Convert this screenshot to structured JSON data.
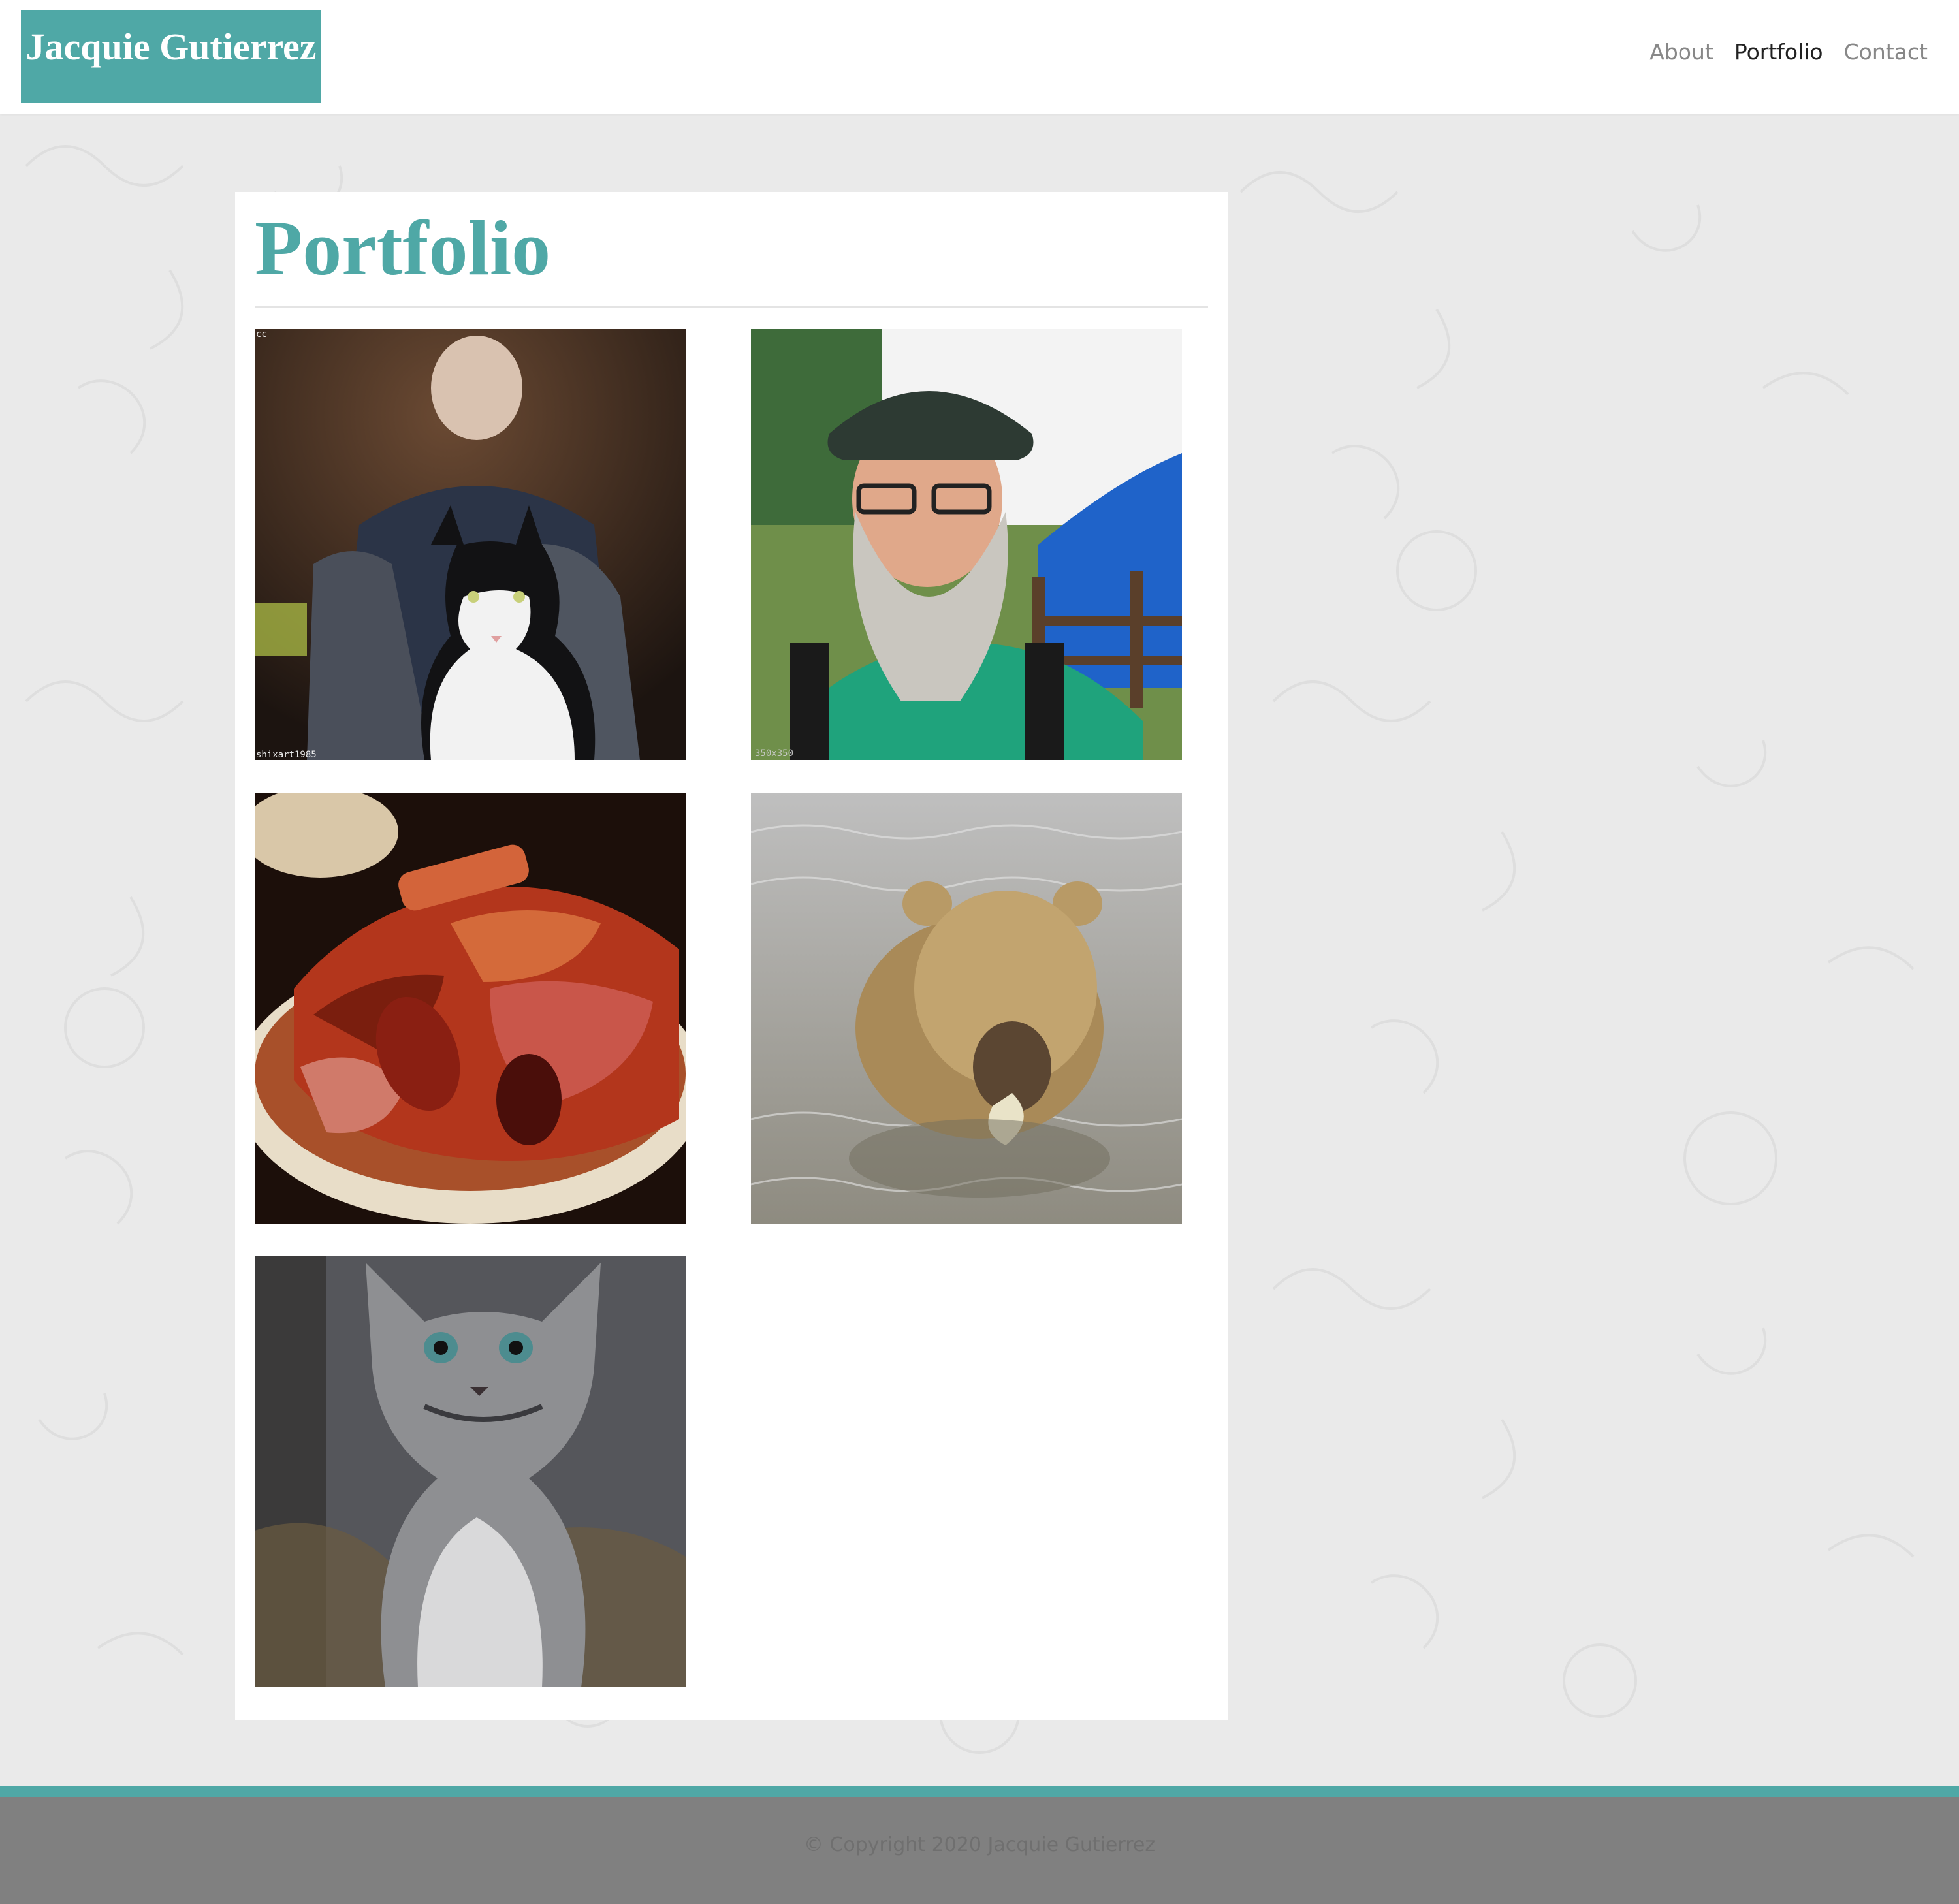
{
  "header": {
    "brand": "Jacquie Gutierrez",
    "nav": [
      {
        "label": "About",
        "active": false
      },
      {
        "label": "Portfolio",
        "active": true
      },
      {
        "label": "Contact",
        "active": false
      }
    ]
  },
  "main": {
    "title": "Portfolio",
    "images": [
      {
        "subject": "old man with black and white cat",
        "watermark_top": "cc",
        "watermark_bottom": "shixart1985"
      },
      {
        "subject": "bearded man in green flat cap",
        "watermark_bottom": "350x350"
      },
      {
        "subject": "plate of barbecue meats"
      },
      {
        "subject": "brown bear in water"
      },
      {
        "subject": "grey tabby kitten"
      }
    ]
  },
  "footer": {
    "copyright": "© Copyright 2020 Jacquie Gutierrez"
  },
  "colors": {
    "accent": "#4fa8a6",
    "footer_bg": "#808080",
    "page_bg": "#eaeaea"
  }
}
